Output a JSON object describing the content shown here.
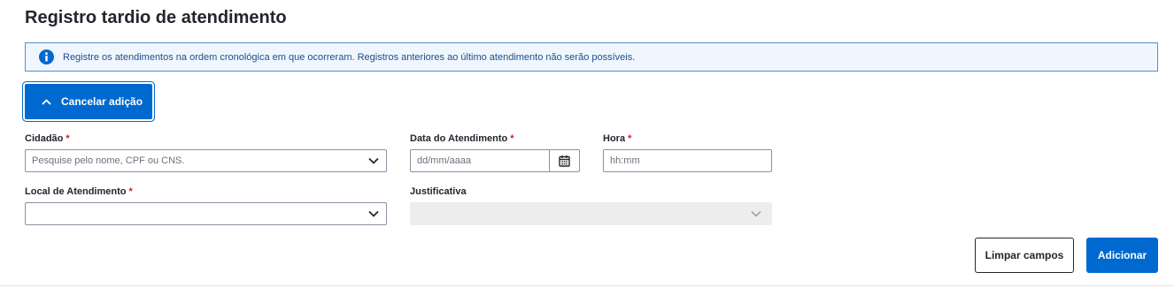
{
  "page": {
    "title": "Registro tardio de atendimento"
  },
  "info_banner": {
    "text": "Registre os atendimentos na ordem cronológica em que ocorreram. Registros anteriores ao último atendimento não serão possíveis.",
    "icon": "info-icon"
  },
  "cancel_button": {
    "label": "Cancelar adição",
    "icon": "chevron-up-icon"
  },
  "form": {
    "cidadao": {
      "label": "Cidadão",
      "required_mark": "*",
      "placeholder": "Pesquise pelo nome, CPF ou CNS.",
      "icon": "chevron-down-icon"
    },
    "data_atendimento": {
      "label": "Data do Atendimento",
      "required_mark": "*",
      "placeholder": "dd/mm/aaaa",
      "icon": "calendar-icon"
    },
    "hora": {
      "label": "Hora",
      "required_mark": "*",
      "placeholder": "hh:mm"
    },
    "local_atendimento": {
      "label": "Local de Atendimento",
      "required_mark": "*",
      "value": "",
      "icon": "chevron-down-icon"
    },
    "justificativa": {
      "label": "Justificativa",
      "value": "",
      "disabled": true,
      "icon": "chevron-down-icon"
    }
  },
  "actions": {
    "clear_label": "Limpar campos",
    "add_label": "Adicionar"
  },
  "colors": {
    "primary": "#0069d0",
    "required": "#d01f1f",
    "banner_bg": "#f0f6fd",
    "banner_border": "#4b92d6"
  }
}
